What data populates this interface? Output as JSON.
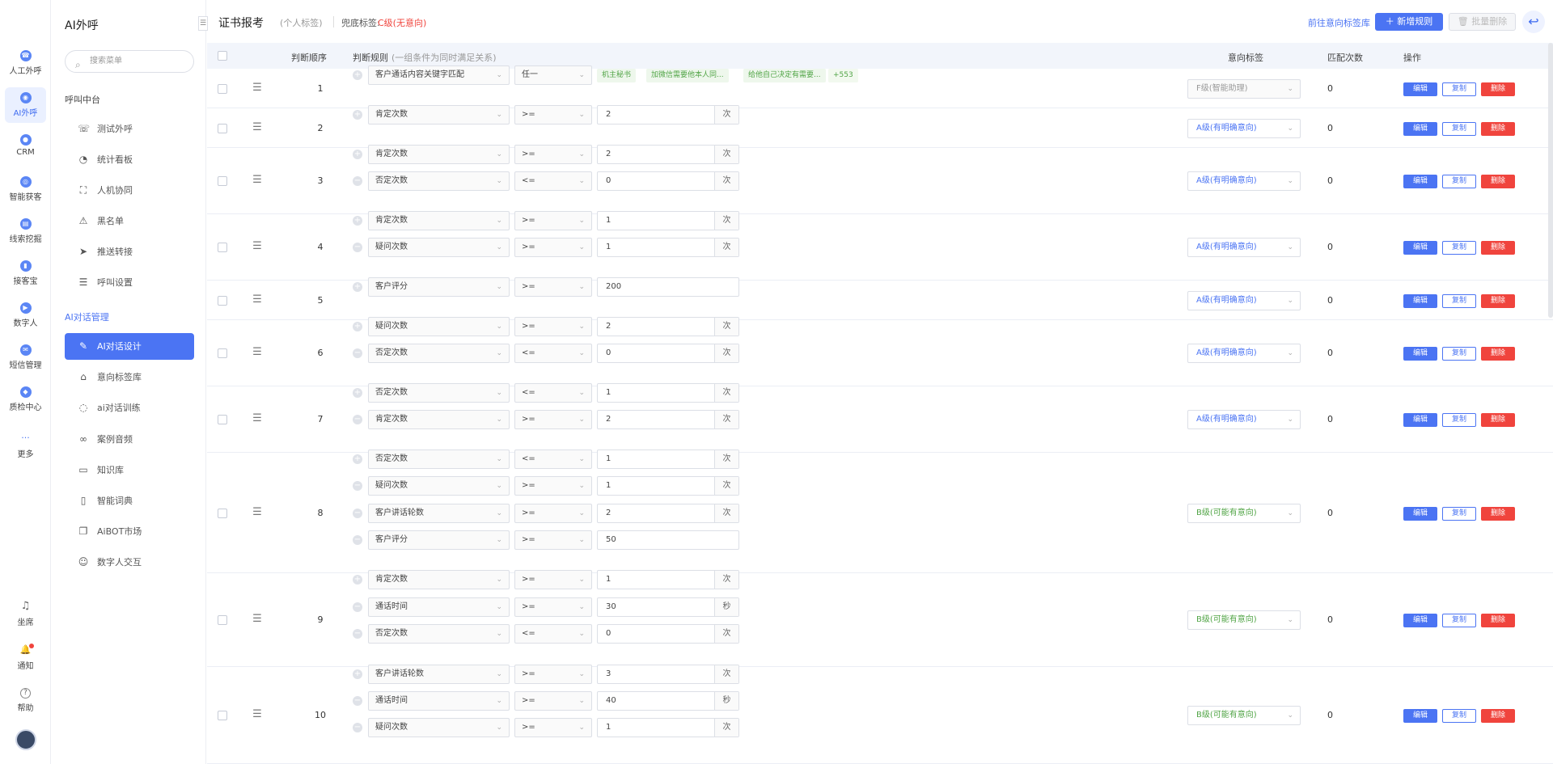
{
  "rail": {
    "items": [
      {
        "label": "人工外呼",
        "icon": "phone-icon"
      },
      {
        "label": "AI外呼",
        "icon": "robot-icon"
      },
      {
        "label": "CRM",
        "icon": "crm-icon"
      },
      {
        "label": "智能获客",
        "icon": "target-icon"
      },
      {
        "label": "线索挖掘",
        "icon": "doc-icon"
      },
      {
        "label": "接客宝",
        "icon": "mobile-icon"
      },
      {
        "label": "数字人",
        "icon": "video-icon"
      },
      {
        "label": "短信管理",
        "icon": "sms-icon"
      },
      {
        "label": "质检中心",
        "icon": "shield-icon"
      },
      {
        "label": "更多",
        "icon": "more-icon"
      }
    ],
    "bottom": [
      {
        "label": "坐席",
        "icon": "headset-icon"
      },
      {
        "label": "通知",
        "icon": "bell-icon"
      },
      {
        "label": "帮助",
        "icon": "help-icon"
      }
    ]
  },
  "menu": {
    "title": "AI外呼",
    "search_placeholder": "搜索菜单",
    "group1": "呼叫中台",
    "group1_items": [
      {
        "label": "测试外呼",
        "icon": "phone-icon"
      },
      {
        "label": "统计看板",
        "icon": "pie-chart-icon"
      },
      {
        "label": "人机协同",
        "icon": "scan-icon"
      },
      {
        "label": "黑名单",
        "icon": "warning-icon"
      },
      {
        "label": "推送转接",
        "icon": "send-icon"
      },
      {
        "label": "呼叫设置",
        "icon": "sliders-icon"
      }
    ],
    "group2": "AI对话管理",
    "group2_items": [
      {
        "label": "AI对话设计",
        "icon": "edit-icon"
      },
      {
        "label": "意向标签库",
        "icon": "tag-icon"
      },
      {
        "label": "ai对话训练",
        "icon": "chat-icon"
      },
      {
        "label": "案例音频",
        "icon": "voicemail-icon"
      },
      {
        "label": "知识库",
        "icon": "laptop-icon"
      },
      {
        "label": "智能词典",
        "icon": "book-icon"
      },
      {
        "label": "AiBOT市场",
        "icon": "store-icon"
      },
      {
        "label": "数字人交互",
        "icon": "person-icon"
      }
    ]
  },
  "header": {
    "title": "证书报考",
    "subtitle": "(个人标签)",
    "fallback_label": "兜底标签:",
    "fallback_value": "C级(无意向)",
    "link_tag_lib": "前往意向标签库",
    "add_rule": "新增规则",
    "batch_delete": "批量删除"
  },
  "table": {
    "headers": {
      "order": "判断顺序",
      "rule": "判断规则",
      "rule_hint": "(一组条件为同时满足关系)",
      "intent": "意向标签",
      "count": "匹配次数",
      "ops": "操作"
    },
    "ops": {
      "edit": "编辑",
      "copy": "复制",
      "del": "删除"
    },
    "rows": [
      {
        "seq": "1",
        "intent": "F级(智能助理)",
        "cls": "F",
        "count": "0",
        "conds": [
          {
            "field": "客户通话内容关键字匹配",
            "op": "任一",
            "tags": [
              "机主秘书",
              "加微信需要他本人同...",
              "给他自己决定有需要...",
              "+553"
            ]
          }
        ]
      },
      {
        "seq": "2",
        "intent": "A级(有明确意向)",
        "cls": "A",
        "count": "0",
        "conds": [
          {
            "field": "肯定次数",
            "op": ">=",
            "value": "2",
            "unit": "次"
          }
        ]
      },
      {
        "seq": "3",
        "intent": "A级(有明确意向)",
        "cls": "A",
        "count": "0",
        "conds": [
          {
            "field": "肯定次数",
            "op": ">=",
            "value": "2",
            "unit": "次"
          },
          {
            "field": "否定次数",
            "op": "<=",
            "value": "0",
            "unit": "次"
          }
        ]
      },
      {
        "seq": "4",
        "intent": "A级(有明确意向)",
        "cls": "A",
        "count": "0",
        "conds": [
          {
            "field": "肯定次数",
            "op": ">=",
            "value": "1",
            "unit": "次"
          },
          {
            "field": "疑问次数",
            "op": ">=",
            "value": "1",
            "unit": "次"
          }
        ]
      },
      {
        "seq": "5",
        "intent": "A级(有明确意向)",
        "cls": "A",
        "count": "0",
        "conds": [
          {
            "field": "客户评分",
            "op": ">=",
            "value": "200",
            "unit": ""
          }
        ]
      },
      {
        "seq": "6",
        "intent": "A级(有明确意向)",
        "cls": "A",
        "count": "0",
        "conds": [
          {
            "field": "疑问次数",
            "op": ">=",
            "value": "2",
            "unit": "次"
          },
          {
            "field": "否定次数",
            "op": "<=",
            "value": "0",
            "unit": "次"
          }
        ]
      },
      {
        "seq": "7",
        "intent": "A级(有明确意向)",
        "cls": "A",
        "count": "0",
        "conds": [
          {
            "field": "否定次数",
            "op": "<=",
            "value": "1",
            "unit": "次"
          },
          {
            "field": "肯定次数",
            "op": ">=",
            "value": "2",
            "unit": "次"
          }
        ]
      },
      {
        "seq": "8",
        "intent": "B级(可能有意向)",
        "cls": "B",
        "count": "0",
        "conds": [
          {
            "field": "否定次数",
            "op": "<=",
            "value": "1",
            "unit": "次"
          },
          {
            "field": "疑问次数",
            "op": ">=",
            "value": "1",
            "unit": "次"
          },
          {
            "field": "客户讲话轮数",
            "op": ">=",
            "value": "2",
            "unit": "次"
          },
          {
            "field": "客户评分",
            "op": ">=",
            "value": "50",
            "unit": ""
          }
        ]
      },
      {
        "seq": "9",
        "intent": "B级(可能有意向)",
        "cls": "B",
        "count": "0",
        "conds": [
          {
            "field": "肯定次数",
            "op": ">=",
            "value": "1",
            "unit": "次"
          },
          {
            "field": "通话时间",
            "op": ">=",
            "value": "30",
            "unit": "秒"
          },
          {
            "field": "否定次数",
            "op": "<=",
            "value": "0",
            "unit": "次"
          }
        ]
      },
      {
        "seq": "10",
        "intent": "B级(可能有意向)",
        "cls": "B",
        "count": "0",
        "conds": [
          {
            "field": "客户讲话轮数",
            "op": ">=",
            "value": "3",
            "unit": "次"
          },
          {
            "field": "通话时间",
            "op": ">=",
            "value": "40",
            "unit": "秒"
          },
          {
            "field": "疑问次数",
            "op": ">=",
            "value": "1",
            "unit": "次"
          }
        ]
      }
    ]
  }
}
